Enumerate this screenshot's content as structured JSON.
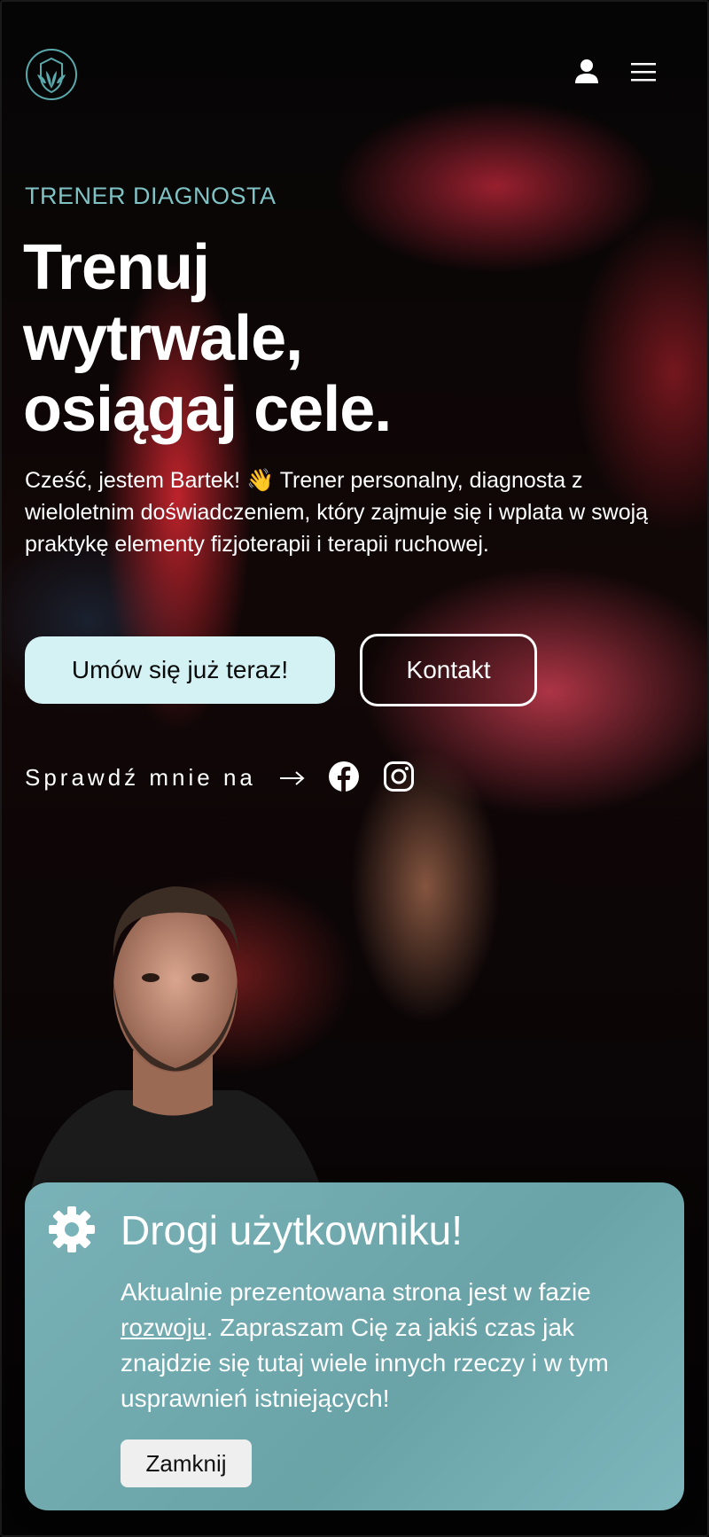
{
  "header": {
    "logo_icon": "shield-leaf-logo-icon",
    "user_icon": "user-icon",
    "menu_icon": "hamburger-menu-icon"
  },
  "hero": {
    "eyebrow": "TRENER DIAGNOSTA",
    "title_line1": "Trenuj",
    "title_line2": "wytrwale,",
    "title_line3": "osiągaj cele.",
    "intro": "Cześć, jestem Bartek! 👋 Trener personalny, diagnosta z wieloletnim doświadczeniem, który zajmuje się i wplata w swoją praktykę elementy fizjoterapii i terapii ruchowej.",
    "primary_button": "Umów się już teraz!",
    "secondary_button": "Kontakt"
  },
  "social": {
    "label": "Sprawdź mnie na",
    "arrow_icon": "arrow-right-icon",
    "facebook_icon": "facebook-icon",
    "instagram_icon": "instagram-icon"
  },
  "notice": {
    "icon": "gear-icon",
    "title": "Drogi użytkowniku!",
    "body_before": "Aktualnie prezentowana strona jest w fazie ",
    "body_link": "rozwoju",
    "body_after": ". Zapraszam Cię za jakiś czas jak znajdzie się tutaj wiele innych rzeczy i w tym usprawnień istniejących!",
    "close_button": "Zamknij"
  },
  "colors": {
    "accent_teal": "#7fc3c4",
    "primary_button_bg": "#d4f2f4",
    "notice_bg": "#7db8be",
    "background": "#000000"
  }
}
